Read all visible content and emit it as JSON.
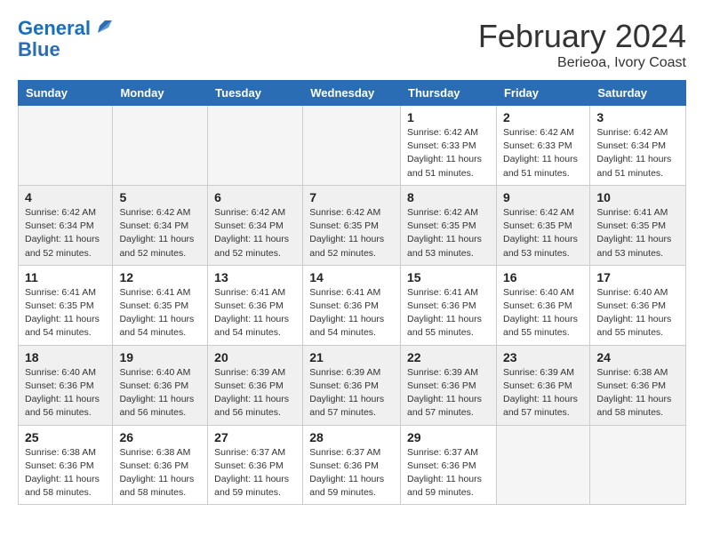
{
  "logo": {
    "line1": "General",
    "line2": "Blue"
  },
  "title": "February 2024",
  "subtitle": "Berieoa, Ivory Coast",
  "days_header": [
    "Sunday",
    "Monday",
    "Tuesday",
    "Wednesday",
    "Thursday",
    "Friday",
    "Saturday"
  ],
  "weeks": [
    [
      {
        "day": "",
        "info": ""
      },
      {
        "day": "",
        "info": ""
      },
      {
        "day": "",
        "info": ""
      },
      {
        "day": "",
        "info": ""
      },
      {
        "day": "1",
        "info": "Sunrise: 6:42 AM\nSunset: 6:33 PM\nDaylight: 11 hours\nand 51 minutes."
      },
      {
        "day": "2",
        "info": "Sunrise: 6:42 AM\nSunset: 6:33 PM\nDaylight: 11 hours\nand 51 minutes."
      },
      {
        "day": "3",
        "info": "Sunrise: 6:42 AM\nSunset: 6:34 PM\nDaylight: 11 hours\nand 51 minutes."
      }
    ],
    [
      {
        "day": "4",
        "info": "Sunrise: 6:42 AM\nSunset: 6:34 PM\nDaylight: 11 hours\nand 52 minutes."
      },
      {
        "day": "5",
        "info": "Sunrise: 6:42 AM\nSunset: 6:34 PM\nDaylight: 11 hours\nand 52 minutes."
      },
      {
        "day": "6",
        "info": "Sunrise: 6:42 AM\nSunset: 6:34 PM\nDaylight: 11 hours\nand 52 minutes."
      },
      {
        "day": "7",
        "info": "Sunrise: 6:42 AM\nSunset: 6:35 PM\nDaylight: 11 hours\nand 52 minutes."
      },
      {
        "day": "8",
        "info": "Sunrise: 6:42 AM\nSunset: 6:35 PM\nDaylight: 11 hours\nand 53 minutes."
      },
      {
        "day": "9",
        "info": "Sunrise: 6:42 AM\nSunset: 6:35 PM\nDaylight: 11 hours\nand 53 minutes."
      },
      {
        "day": "10",
        "info": "Sunrise: 6:41 AM\nSunset: 6:35 PM\nDaylight: 11 hours\nand 53 minutes."
      }
    ],
    [
      {
        "day": "11",
        "info": "Sunrise: 6:41 AM\nSunset: 6:35 PM\nDaylight: 11 hours\nand 54 minutes."
      },
      {
        "day": "12",
        "info": "Sunrise: 6:41 AM\nSunset: 6:35 PM\nDaylight: 11 hours\nand 54 minutes."
      },
      {
        "day": "13",
        "info": "Sunrise: 6:41 AM\nSunset: 6:36 PM\nDaylight: 11 hours\nand 54 minutes."
      },
      {
        "day": "14",
        "info": "Sunrise: 6:41 AM\nSunset: 6:36 PM\nDaylight: 11 hours\nand 54 minutes."
      },
      {
        "day": "15",
        "info": "Sunrise: 6:41 AM\nSunset: 6:36 PM\nDaylight: 11 hours\nand 55 minutes."
      },
      {
        "day": "16",
        "info": "Sunrise: 6:40 AM\nSunset: 6:36 PM\nDaylight: 11 hours\nand 55 minutes."
      },
      {
        "day": "17",
        "info": "Sunrise: 6:40 AM\nSunset: 6:36 PM\nDaylight: 11 hours\nand 55 minutes."
      }
    ],
    [
      {
        "day": "18",
        "info": "Sunrise: 6:40 AM\nSunset: 6:36 PM\nDaylight: 11 hours\nand 56 minutes."
      },
      {
        "day": "19",
        "info": "Sunrise: 6:40 AM\nSunset: 6:36 PM\nDaylight: 11 hours\nand 56 minutes."
      },
      {
        "day": "20",
        "info": "Sunrise: 6:39 AM\nSunset: 6:36 PM\nDaylight: 11 hours\nand 56 minutes."
      },
      {
        "day": "21",
        "info": "Sunrise: 6:39 AM\nSunset: 6:36 PM\nDaylight: 11 hours\nand 57 minutes."
      },
      {
        "day": "22",
        "info": "Sunrise: 6:39 AM\nSunset: 6:36 PM\nDaylight: 11 hours\nand 57 minutes."
      },
      {
        "day": "23",
        "info": "Sunrise: 6:39 AM\nSunset: 6:36 PM\nDaylight: 11 hours\nand 57 minutes."
      },
      {
        "day": "24",
        "info": "Sunrise: 6:38 AM\nSunset: 6:36 PM\nDaylight: 11 hours\nand 58 minutes."
      }
    ],
    [
      {
        "day": "25",
        "info": "Sunrise: 6:38 AM\nSunset: 6:36 PM\nDaylight: 11 hours\nand 58 minutes."
      },
      {
        "day": "26",
        "info": "Sunrise: 6:38 AM\nSunset: 6:36 PM\nDaylight: 11 hours\nand 58 minutes."
      },
      {
        "day": "27",
        "info": "Sunrise: 6:37 AM\nSunset: 6:36 PM\nDaylight: 11 hours\nand 59 minutes."
      },
      {
        "day": "28",
        "info": "Sunrise: 6:37 AM\nSunset: 6:36 PM\nDaylight: 11 hours\nand 59 minutes."
      },
      {
        "day": "29",
        "info": "Sunrise: 6:37 AM\nSunset: 6:36 PM\nDaylight: 11 hours\nand 59 minutes."
      },
      {
        "day": "",
        "info": ""
      },
      {
        "day": "",
        "info": ""
      }
    ]
  ]
}
